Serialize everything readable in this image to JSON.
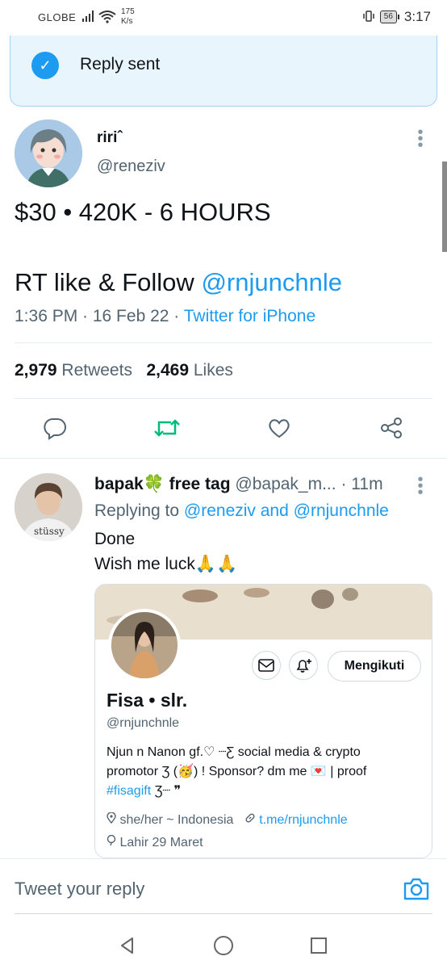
{
  "status_bar": {
    "carrier": "GLOBE",
    "speed_value": "175",
    "speed_unit": "K/s",
    "battery": "56",
    "time": "3:17"
  },
  "toast": {
    "text": "Reply sent",
    "color": "#1d9bf0"
  },
  "tweet": {
    "author_name": "ririˆ",
    "author_handle": "@reneziv",
    "line1": "$30 • 420K - 6 HOURS",
    "line2_prefix": "RT like & Follow ",
    "line2_mention": "@rnjunchnle",
    "timestamp": "1:36 PM · 16 Feb 22 · ",
    "source": "Twitter for iPhone",
    "retweets_count": "2,979",
    "retweets_label": "Retweets",
    "likes_count": "2,469",
    "likes_label": "Likes",
    "actions": [
      "reply-icon",
      "retweet-icon",
      "like-icon",
      "share-icon"
    ],
    "retweet_color": "#00ba7c"
  },
  "reply": {
    "author_name": "bapak🍀 free tag",
    "author_handle": "@bapak_m...",
    "time": "· 11m",
    "replying_prefix": "Replying to ",
    "replying_user1": "@reneziv",
    "replying_and": " and ",
    "replying_user2": "@rnjunchnle",
    "text_line1": "Done",
    "text_line2": "Wish me luck🙏🙏"
  },
  "card": {
    "follow_label": "Mengikuti",
    "name": "Fisa • slr.",
    "handle": "@rnjunchnle",
    "bio_line1": "Njun n Nanon gf.♡  ┈Ƹ social media & crypto",
    "bio_line2": "promotor Ʒ (🥳) ! Sponsor? dm me 💌 | proof",
    "bio_tag": "#fisagift",
    "bio_tag_suffix": " Ʒ┈ ❞",
    "location": "she/her ~ Indonesia",
    "link": "t.me/rnjunchnle",
    "born": "Lahir 29 Maret"
  },
  "reply_bar": {
    "placeholder": "Tweet your reply"
  }
}
